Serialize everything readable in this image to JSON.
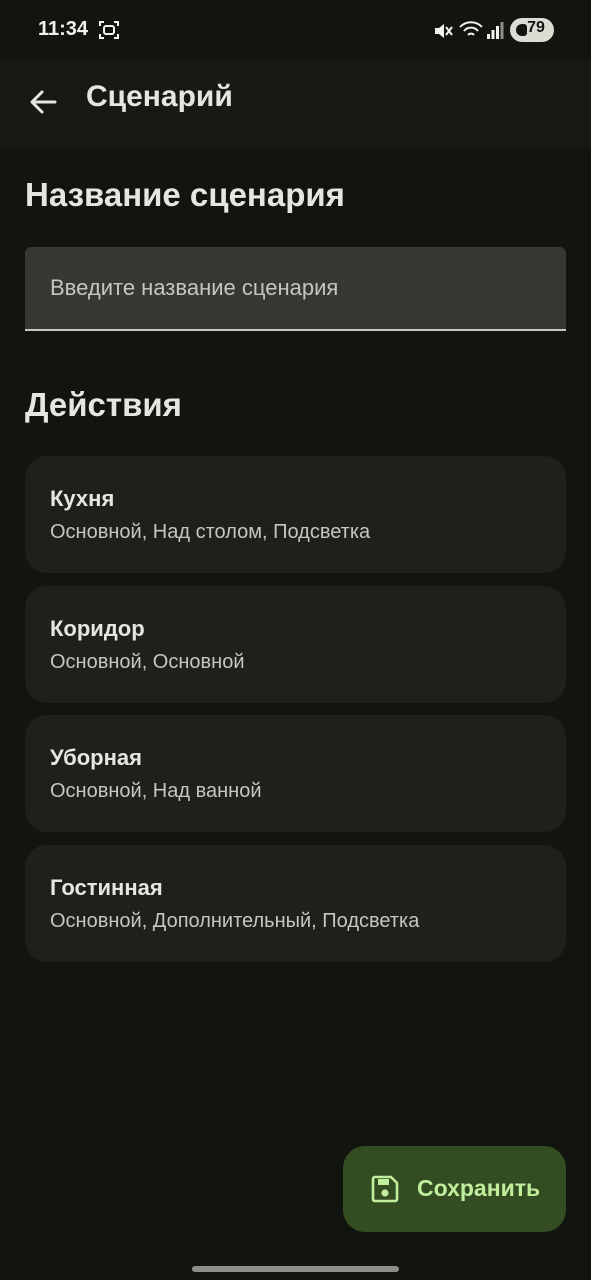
{
  "status_bar": {
    "time": "11:34",
    "battery": "79"
  },
  "app_bar": {
    "title": "Сценарий",
    "back_icon": "arrow-back-icon"
  },
  "name_section": {
    "title": "Название сценария",
    "placeholder": "Введите название сценария",
    "value": ""
  },
  "actions_section": {
    "title": "Действия",
    "items": [
      {
        "title": "Кухня",
        "subtitle": "Основной, Над столом, Подсветка"
      },
      {
        "title": "Коридор",
        "subtitle": "Основной, Основной"
      },
      {
        "title": "Уборная",
        "subtitle": "Основной, Над ванной"
      },
      {
        "title": "Гостинная",
        "subtitle": "Основной, Дополнительный, Подсветка"
      }
    ]
  },
  "fab": {
    "label": "Сохранить",
    "icon": "save-icon"
  },
  "colors": {
    "background": "#121410",
    "surface": "#1e201c",
    "fab_background": "#344c22",
    "fab_foreground": "#c1ee9c"
  }
}
